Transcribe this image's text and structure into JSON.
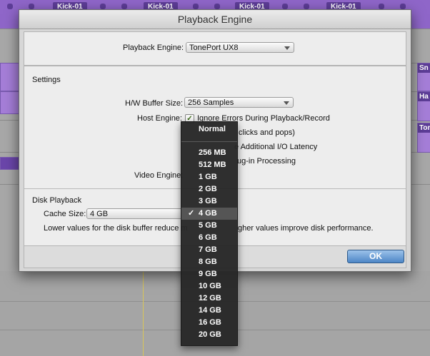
{
  "background": {
    "clip_labels": [
      "Kick-01",
      "Kick-01",
      "Kick-01",
      "Kick-01"
    ],
    "right_clip_labels": [
      "Sn",
      "Ha",
      "Tom"
    ]
  },
  "dialog": {
    "title": "Playback Engine",
    "playback_engine_label": "Playback Engine:",
    "playback_engine_value": "TonePort UX8",
    "settings_heading": "Settings",
    "hw_buffer_label": "H/W Buffer Size:",
    "hw_buffer_value": "256 Samples",
    "host_engine_label": "Host Engine:",
    "host_engine_options": [
      {
        "text": "Ignore Errors During Playback/Record",
        "checked": true
      },
      {
        "text": "clicks and pops)",
        "checked": false
      },
      {
        "text": "e Additional I/O Latency",
        "checked": false
      },
      {
        "text": "ug-in Processing",
        "checked": false
      }
    ],
    "video_engine_label": "Video Engine:",
    "disk_playback_heading": "Disk Playback",
    "cache_size_label": "Cache Size:",
    "cache_size_value": "4 GB",
    "hint_left": "Lower values for the disk buffer reduce m",
    "hint_right": "gher values improve disk performance.",
    "ok_label": "OK"
  },
  "cache_menu": {
    "header": "Normal",
    "items": [
      "256 MB",
      "512 MB",
      "1 GB",
      "2 GB",
      "3 GB",
      "4 GB",
      "5 GB",
      "6 GB",
      "7 GB",
      "8 GB",
      "9 GB",
      "10 GB",
      "12 GB",
      "14 GB",
      "16 GB",
      "20 GB"
    ],
    "selected": "4 GB",
    "check_glyph": "✓"
  }
}
